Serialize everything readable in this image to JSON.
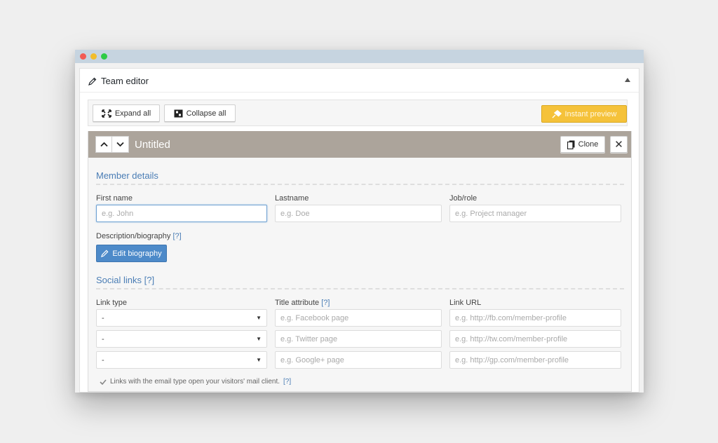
{
  "window": {
    "controls": [
      "close",
      "minimize",
      "maximize"
    ]
  },
  "panel": {
    "title": "Team editor",
    "title_icon": "pencil-icon"
  },
  "toolbar": {
    "expand_label": "Expand all",
    "collapse_label": "Collapse all",
    "preview_label": "Instant preview"
  },
  "member": {
    "name": "Untitled",
    "clone_label": "Clone",
    "close_label": "✕"
  },
  "details": {
    "title": "Member details",
    "first_name_label": "First name",
    "first_name_placeholder": "e.g. John",
    "lastname_label": "Lastname",
    "lastname_placeholder": "e.g. Doe",
    "job_label": "Job/role",
    "job_placeholder": "e.g. Project manager",
    "bio_label": "Description/biography",
    "bio_help": "[?]",
    "bio_button": "Edit biography"
  },
  "social": {
    "title": "Social links",
    "title_help": "[?]",
    "col_type": "Link type",
    "col_title": "Title attribute",
    "col_title_help": "[?]",
    "col_url": "Link URL",
    "rows": [
      {
        "type": "-",
        "title_placeholder": "e.g. Facebook page",
        "url_placeholder": "e.g. http://fb.com/member-profile"
      },
      {
        "type": "-",
        "title_placeholder": "e.g. Twitter page",
        "url_placeholder": "e.g. http://tw.com/member-profile"
      },
      {
        "type": "-",
        "title_placeholder": "e.g. Google+ page",
        "url_placeholder": "e.g. http://gp.com/member-profile"
      }
    ],
    "note": "Links with the email type open your visitors' mail client.",
    "note_help": "[?]"
  },
  "colors": {
    "preview_button": "#f5c23a",
    "member_header": "#aca49b",
    "accent_blue": "#4a7db5",
    "bio_button": "#4d8ac9"
  }
}
